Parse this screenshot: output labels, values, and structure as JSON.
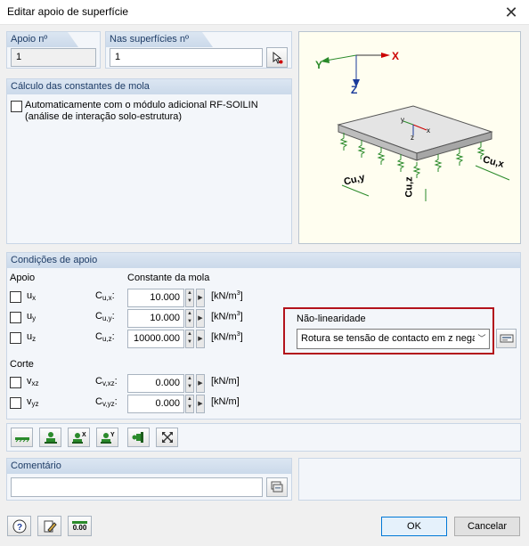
{
  "window": {
    "title": "Editar apoio de superfície",
    "close_glyph": "✕"
  },
  "apoio_no": {
    "label": "Apoio nº",
    "value": "1"
  },
  "surfaces": {
    "label": "Nas superfícies nº",
    "value": "1"
  },
  "spring_calc": {
    "header": "Cálculo das constantes de mola",
    "auto_line1": "Automaticamente com o módulo adicional RF-SOILIN",
    "auto_line2": "(análise de interação solo-estrutura)"
  },
  "diagram": {
    "axis_y": "Y",
    "axis_x": "X",
    "axis_z": "Z",
    "mini_y": "y",
    "mini_x": "x",
    "mini_z": "z",
    "label_cuy": "Cu,y",
    "label_cuz": "Cu,z",
    "label_cux": "Cu,x"
  },
  "support": {
    "header": "Condições de apoio",
    "apoio_label": "Apoio",
    "const_label": "Constante da mola",
    "rows": [
      {
        "sym": "u",
        "sub": "x",
        "c": "C",
        "csub": "u,x",
        "value": "10.000",
        "unit": "[kN/m",
        "unit_sup": "3",
        "unit_end": "]"
      },
      {
        "sym": "u",
        "sub": "y",
        "c": "C",
        "csub": "u,y",
        "value": "10.000",
        "unit": "[kN/m",
        "unit_sup": "3",
        "unit_end": "]"
      },
      {
        "sym": "u",
        "sub": "z",
        "c": "C",
        "csub": "u,z",
        "value": "10000.000",
        "unit": "[kN/m",
        "unit_sup": "3",
        "unit_end": "]"
      }
    ],
    "corte_label": "Corte",
    "shear": [
      {
        "sym": "v",
        "sub": "xz",
        "c": "C",
        "csub": "v,xz",
        "value": "0.000",
        "unit": "[kN/m]"
      },
      {
        "sym": "v",
        "sub": "yz",
        "c": "C",
        "csub": "v,yz",
        "value": "0.000",
        "unit": "[kN/m]"
      }
    ],
    "colon": ":",
    "nonlin_label": "Não-linearidade",
    "nonlin_value": "Rotura se tensão de contacto em z nega"
  },
  "comment": {
    "label": "Comentário",
    "value": ""
  },
  "buttons": {
    "ok": "OK",
    "cancel": "Cancelar",
    "units": "0.00"
  }
}
